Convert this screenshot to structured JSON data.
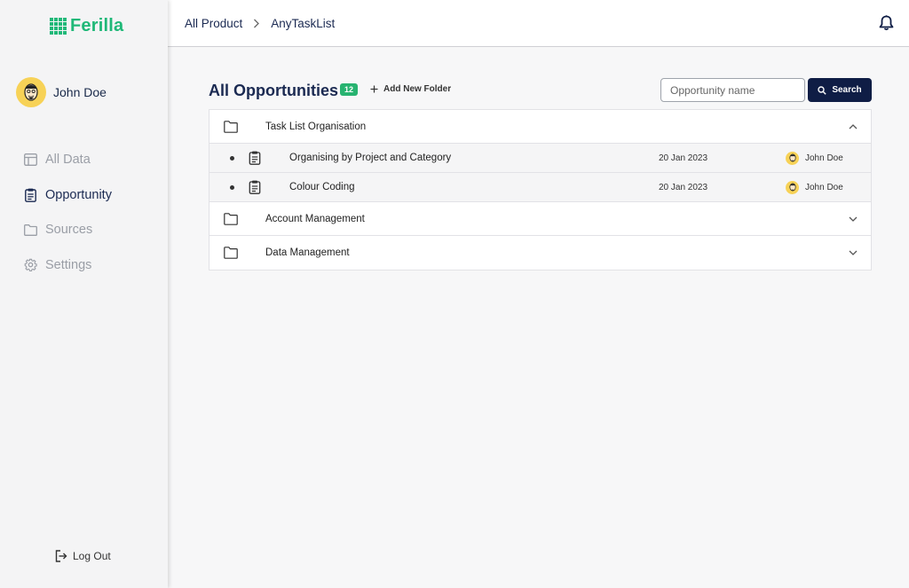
{
  "app": {
    "logo_text": "Ferilla",
    "brand_color": "#1fb878"
  },
  "user": {
    "name": "John Doe"
  },
  "sidebar": {
    "items": [
      {
        "label": "All Data",
        "icon": "table-icon",
        "active": false
      },
      {
        "label": "Opportunity",
        "icon": "clipboard-icon",
        "active": true
      },
      {
        "label": "Sources",
        "icon": "folder-icon",
        "active": false
      },
      {
        "label": "Settings",
        "icon": "gear-icon",
        "active": false
      }
    ],
    "logout_label": "Log Out"
  },
  "header": {
    "breadcrumb": [
      "All Product",
      "AnyTaskList"
    ]
  },
  "main": {
    "title": "All Opportunities",
    "count": "12",
    "add_folder_label": "Add New Folder",
    "search": {
      "placeholder": "Opportunity name",
      "button_label": "Search"
    },
    "folders": [
      {
        "name": "Task List Organisation",
        "expanded": true,
        "tasks": [
          {
            "name": "Organising by Project and Category",
            "date": "20 Jan 2023",
            "owner": "John Doe"
          },
          {
            "name": "Colour Coding",
            "date": "20 Jan 2023",
            "owner": "John Doe"
          }
        ]
      },
      {
        "name": "Account Management",
        "expanded": false
      },
      {
        "name": "Data Management",
        "expanded": false
      }
    ]
  }
}
